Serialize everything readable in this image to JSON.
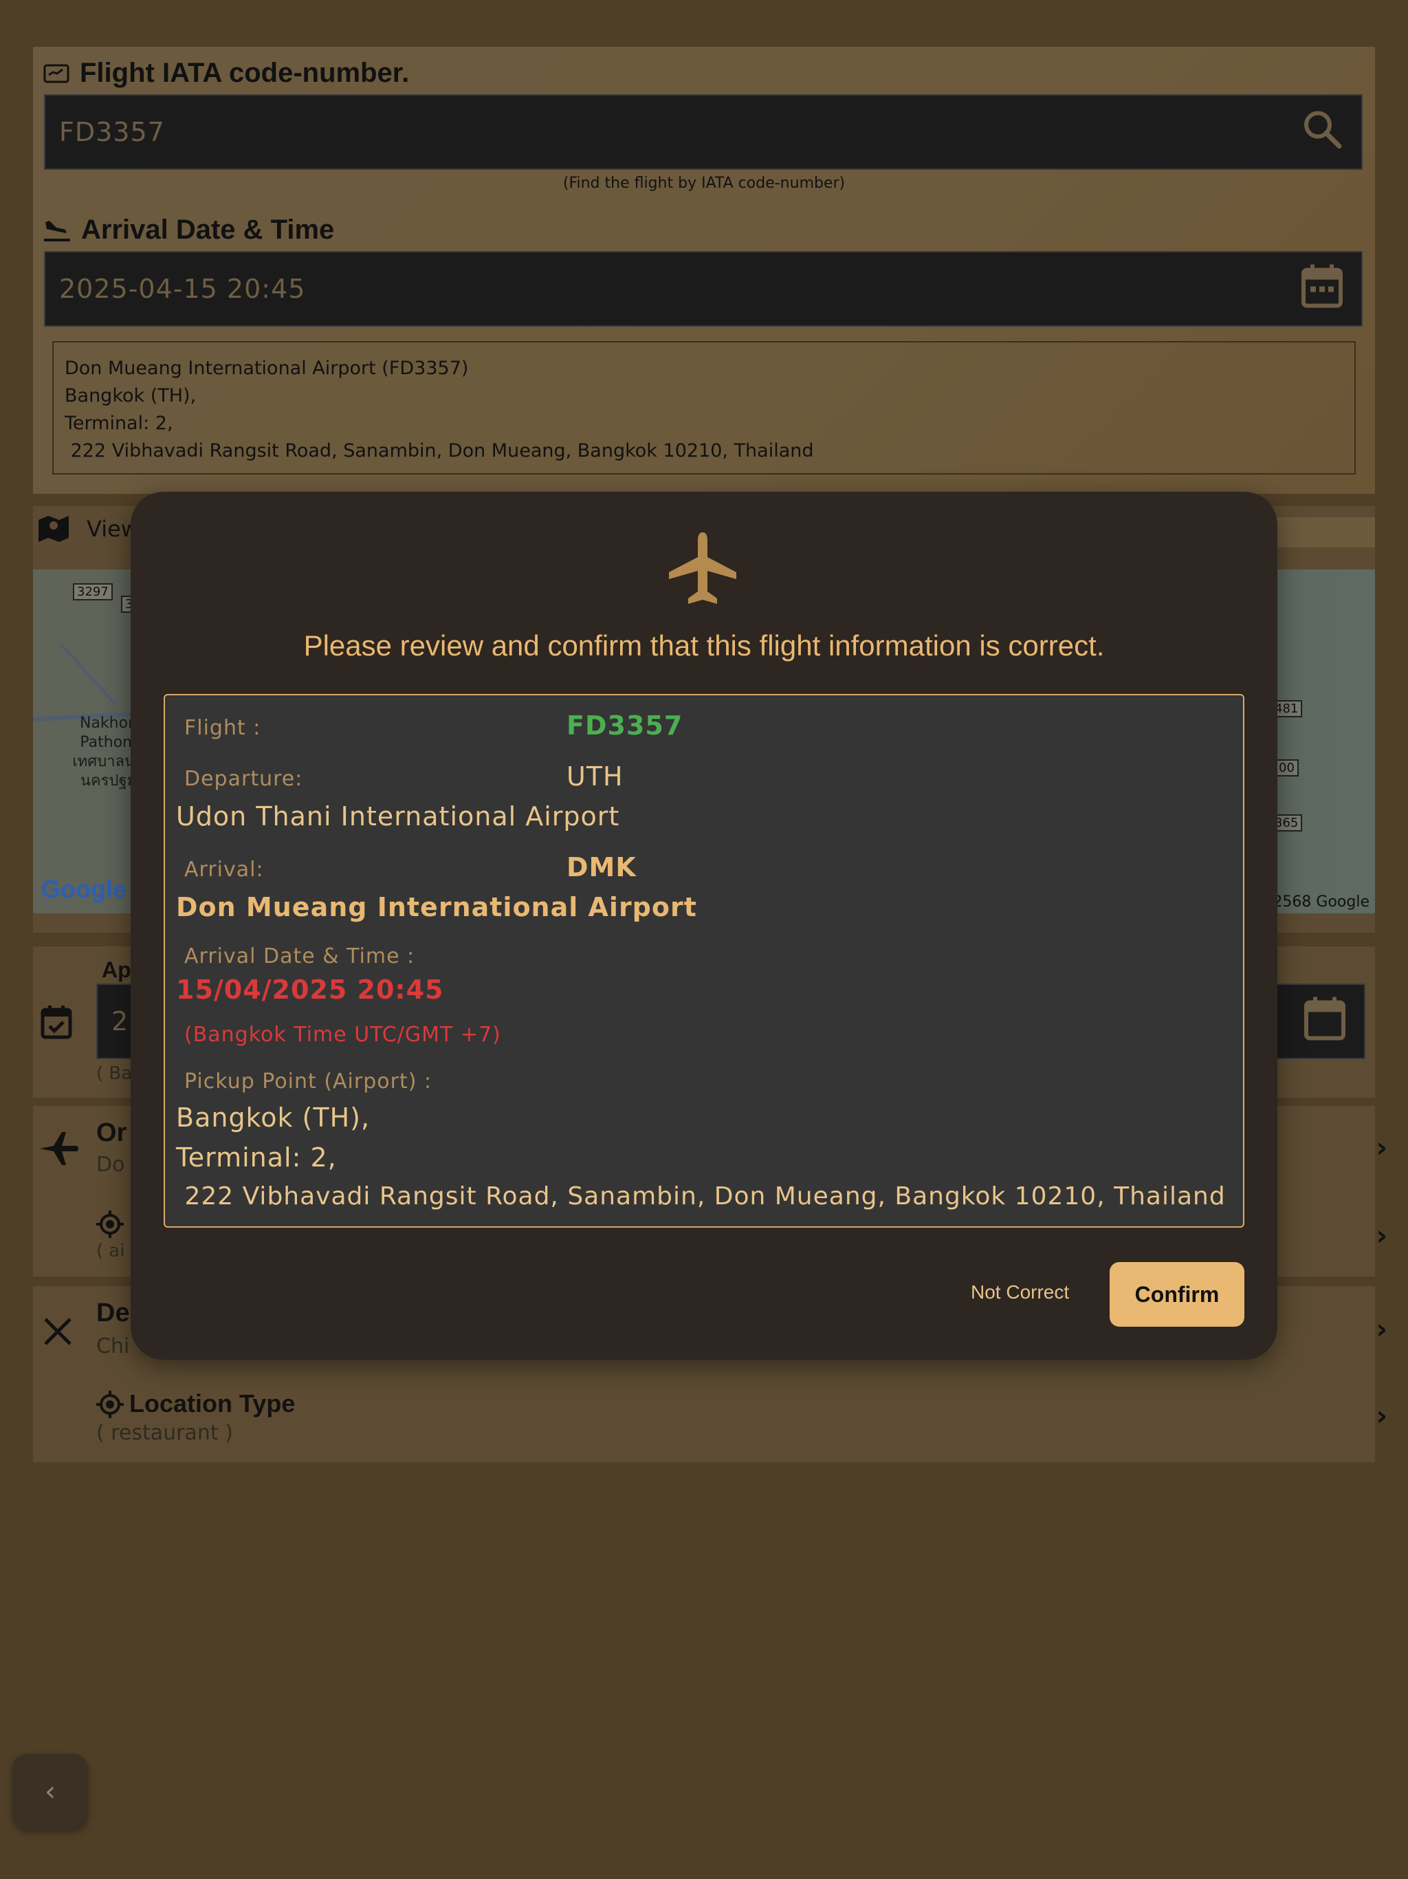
{
  "flight_field": {
    "label": "Flight IATA code-number.",
    "value": "FD3357",
    "helper": "(Find the flight by IATA code-number)"
  },
  "arrival_field": {
    "label": "Arrival Date & Time",
    "value": "2025-04-15 20:45"
  },
  "address_box": {
    "line1": "Don Mueang International Airport (FD3357)",
    "line2": "Bangkok (TH),",
    "line3": "Terminal: 2,",
    "line4": " 222 Vibhavadi Rangsit Road, Sanambin, Don Mueang, Bangkok 10210, Thailand"
  },
  "map": {
    "view_label": "View",
    "place_label": "Nakhon\nPathom\nเทศบาลนค\nนครปฐม",
    "shields": [
      "3297",
      "3",
      "481",
      "00",
      "365"
    ],
    "copyright": "2568 Google",
    "logo": "Google"
  },
  "appointment": {
    "label": "Ap",
    "value": "2",
    "sub": "( Ba"
  },
  "origin": {
    "title": "Or",
    "sub": "Do"
  },
  "origin_location": {
    "sub": "( ai"
  },
  "destination": {
    "title": "De",
    "sub": "Chi"
  },
  "location_type": {
    "title": "Location Type",
    "sub": "( restaurant )"
  },
  "modal": {
    "title": "Please review and confirm that this flight information is correct.",
    "flight_label": "Flight :",
    "flight_value": "FD3357",
    "departure_label": "Departure:",
    "departure_code": "UTH",
    "departure_name": "Udon Thani International Airport",
    "arrival_label": "Arrival:",
    "arrival_code": "DMK",
    "arrival_name": "Don Mueang International Airport",
    "arrival_dt_label": "Arrival Date & Time :",
    "arrival_dt_value": "15/04/2025 20:45",
    "timezone_note": "(Bangkok Time UTC/GMT +7)",
    "pickup_label": "Pickup Point (Airport) :",
    "pickup_line1": "Bangkok (TH),",
    "pickup_line2": "Terminal: 2,",
    "pickup_line3": " 222 Vibhavadi Rangsit Road, Sanambin, Don Mueang, Bangkok 10210, Thailand",
    "not_correct_label": "Not Correct",
    "confirm_label": "Confirm"
  },
  "colors": {
    "accent": "#e9b872",
    "flight_green": "#4caf50",
    "arrival_red": "#d93a3a",
    "modal_bg": "#2e2620",
    "info_bg": "#353535"
  },
  "icons": [
    "ticket-icon",
    "flight-land-icon",
    "search-icon",
    "calendar-icon",
    "map-icon",
    "event-available-icon",
    "airplane-icon",
    "target-icon",
    "restaurant-icon",
    "chevron-right-icon",
    "chevron-left-icon"
  ]
}
